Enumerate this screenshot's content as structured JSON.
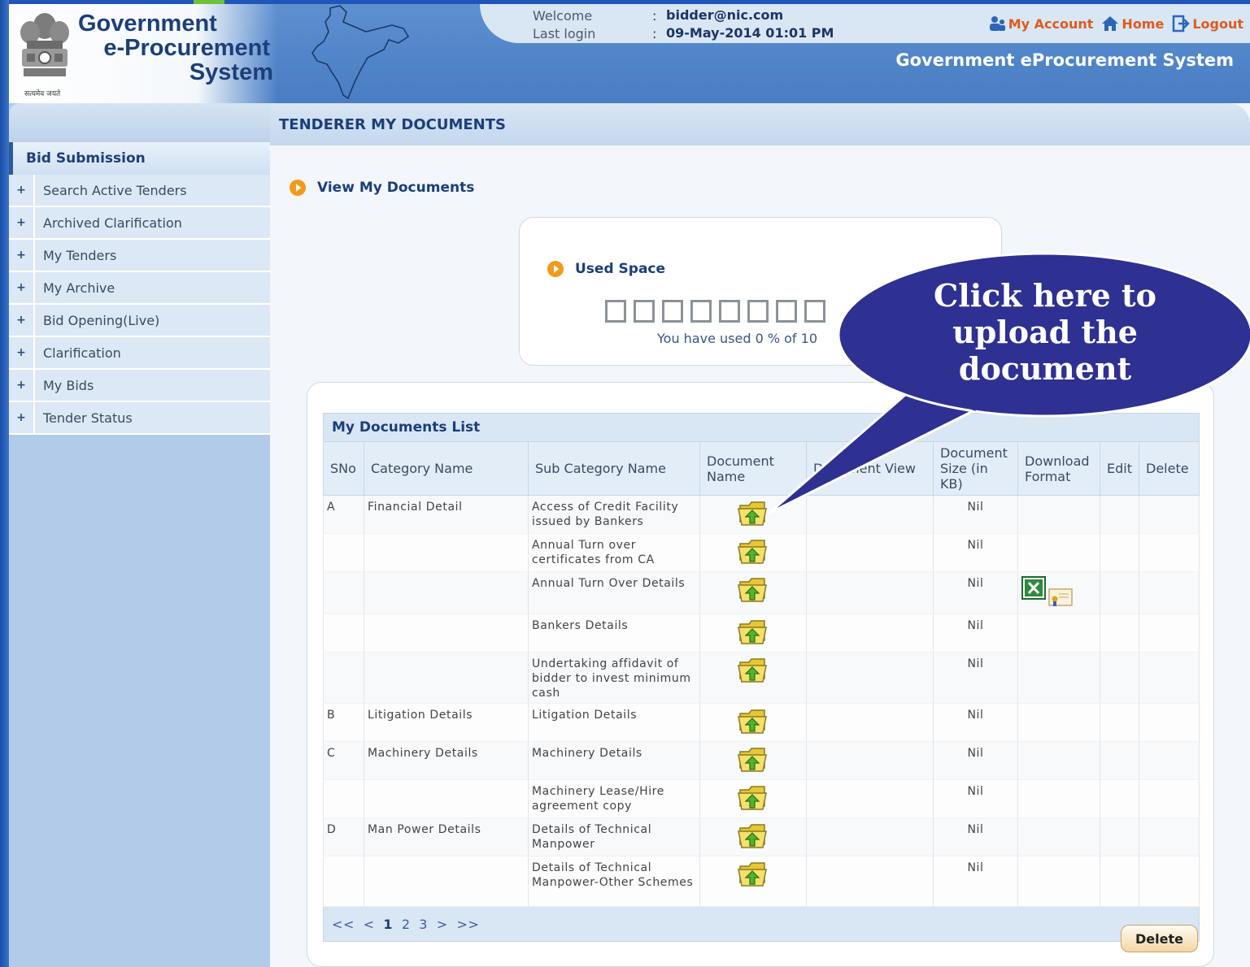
{
  "header": {
    "logo_line1": "Government",
    "logo_line2": "e-Procurement",
    "logo_line3": "System",
    "emblem_caption": "सत्यमेव जयते",
    "welcome_label": "Welcome",
    "welcome_value": "bidder@nic.com",
    "last_login_label": "Last login",
    "last_login_value": "09-May-2014 01:01 PM",
    "separator": ":",
    "links": {
      "my_account": "My Account",
      "home": "Home",
      "logout": "Logout"
    },
    "system_title": "Government eProcurement System"
  },
  "sidebar": {
    "section_title": "Bid Submission",
    "items": [
      {
        "label": "Search Active Tenders"
      },
      {
        "label": "Archived Clarification"
      },
      {
        "label": "My Tenders"
      },
      {
        "label": "My Archive"
      },
      {
        "label": "Bid Opening(Live)"
      },
      {
        "label": "Clarification"
      },
      {
        "label": "My Bids"
      },
      {
        "label": "Tender Status"
      }
    ]
  },
  "main": {
    "page_title": "TENDERER MY DOCUMENTS",
    "view_link": "View My Documents",
    "used_space": {
      "title": "Used Space",
      "text": "You have used 0 % of 10",
      "percent_used": 0
    },
    "documents": {
      "title": "My Documents List",
      "columns": {
        "sno": "SNo",
        "category": "Category Name",
        "subcategory": "Sub Category Name",
        "doc_name": "Document Name",
        "doc_view": "Document View",
        "doc_size": "Document Size (in KB)",
        "download": "Download Format",
        "edit": "Edit",
        "delete": "Delete"
      },
      "rows": [
        {
          "sno": "A",
          "category": "Financial Detail",
          "subcategory": "Access of Credit Facility issued by Bankers",
          "size": "Nil",
          "download": false
        },
        {
          "sno": "",
          "category": "",
          "subcategory": "Annual Turn over certificates from CA",
          "size": "Nil",
          "download": false
        },
        {
          "sno": "",
          "category": "",
          "subcategory": "Annual Turn Over Details",
          "size": "Nil",
          "download": true
        },
        {
          "sno": "",
          "category": "",
          "subcategory": "Bankers Details",
          "size": "Nil",
          "download": false
        },
        {
          "sno": "",
          "category": "",
          "subcategory": "Undertaking affidavit of bidder to invest minimum cash",
          "size": "Nil",
          "download": false
        },
        {
          "sno": "B",
          "category": "Litigation Details",
          "subcategory": "Litigation Details",
          "size": "Nil",
          "download": false
        },
        {
          "sno": "C",
          "category": "Machinery Details",
          "subcategory": "Machinery Details",
          "size": "Nil",
          "download": false
        },
        {
          "sno": "",
          "category": "",
          "subcategory": "Machinery Lease/Hire agreement copy",
          "size": "Nil",
          "download": false
        },
        {
          "sno": "D",
          "category": "Man Power Details",
          "subcategory": "Details of Technical Manpower",
          "size": "Nil",
          "download": false
        },
        {
          "sno": "",
          "category": "",
          "subcategory": "Details of Technical Manpower-Other Schemes",
          "size": "Nil",
          "download": false
        }
      ],
      "pager": {
        "first": "<<",
        "prev": "<",
        "pages": [
          "1",
          "2",
          "3"
        ],
        "current": "1",
        "next": ">",
        "last": ">>"
      }
    },
    "delete_button": "Delete"
  },
  "callout": {
    "line1": "Click here to",
    "line2": "upload the",
    "line3": "document",
    "fill": "#2e3192"
  },
  "colors": {
    "header_blue": "#4f84c8",
    "title_navy": "#1c3f7a",
    "link_orange": "#e05a1c",
    "sidebar_bg": "#b2cbe8"
  },
  "icons": {
    "upload": "folder-upload-icon",
    "excel": "excel-icon",
    "certificate": "certificate-icon",
    "user": "user-icon",
    "home": "home-icon",
    "logout": "logout-icon"
  }
}
